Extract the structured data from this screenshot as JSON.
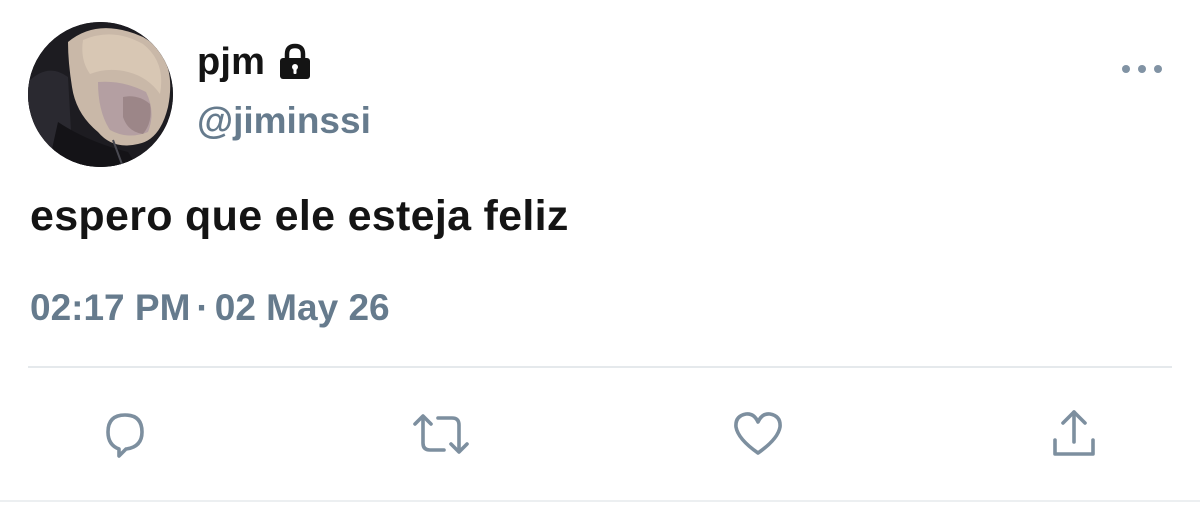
{
  "tweet": {
    "display_name": "pjm",
    "handle": "@jiminssi",
    "text": "espero que ele esteja feliz",
    "time": "02:17 PM",
    "separator": "·",
    "date": "02 May 26"
  },
  "icons": {
    "account": "lock-icon",
    "more": "more-icon",
    "reply": "reply-icon",
    "retweet": "retweet-icon",
    "like": "like-icon",
    "share": "share-icon"
  },
  "colors": {
    "text": "#141414",
    "secondary": "#667b8d",
    "icon": "#8193a4",
    "divider": "#e5e9ec"
  }
}
